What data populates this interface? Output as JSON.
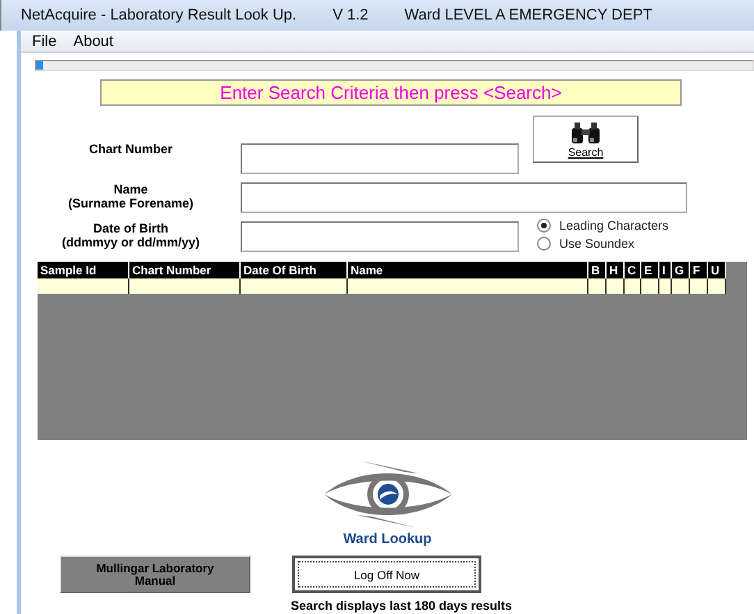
{
  "window": {
    "title": "NetAcquire - Laboratory Result Look Up.",
    "version": "V 1.2",
    "ward": "Ward LEVEL A EMERGENCY DEPT"
  },
  "menu": [
    {
      "label": "File"
    },
    {
      "label": "About"
    }
  ],
  "progress": {
    "level": 0.01
  },
  "banner": "Enter Search Criteria then press <Search>",
  "fields": [
    {
      "label": "Chart Number"
    },
    {
      "label": "Name",
      "hint": "(Surname Forename)"
    },
    {
      "label": "Date of Birth",
      "hint": "(ddmmyy or dd/mm/yy)"
    }
  ],
  "search_button": {
    "label": "Search"
  },
  "match_options": [
    {
      "label": "Leading Characters",
      "selected": true
    },
    {
      "label": "Use Soundex",
      "selected": false
    }
  ],
  "table": {
    "columns": [
      "Sample Id",
      "Chart Number",
      "Date Of Birth",
      "Name",
      "B",
      "H",
      "C",
      "E",
      "I",
      "G",
      "F",
      "U"
    ]
  },
  "logo": {
    "caption": "Ward Lookup"
  },
  "buttons": [
    {
      "label": "Mullingar Laboratory Manual",
      "kind": "flat"
    },
    {
      "label": "Log Off Now",
      "kind": "focused"
    }
  ],
  "footer": "Search displays last 180 days results"
}
